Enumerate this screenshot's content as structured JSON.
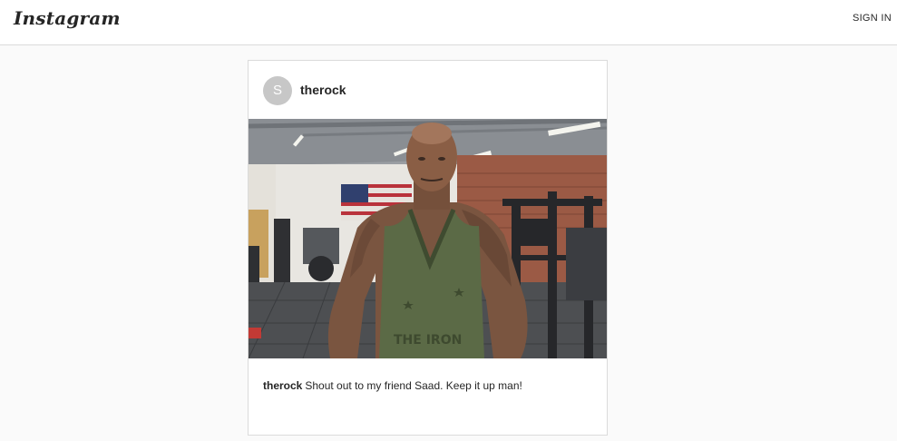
{
  "header": {
    "logo_text": "Instagram",
    "signin_label": "SIGN IN"
  },
  "post": {
    "avatar_letter": "S",
    "username": "therock",
    "image_alt": "Man in a green tank top posing in a gym with an American flag on the wall",
    "shirt_text": "THE IRON",
    "caption": {
      "username": "therock",
      "text": "Shout out to my friend Saad. Keep it up man!"
    }
  },
  "colors": {
    "page_background": "#fafafa",
    "card_border": "#dbdbdb",
    "text": "#262626",
    "avatar_background": "#c7c7c7"
  }
}
